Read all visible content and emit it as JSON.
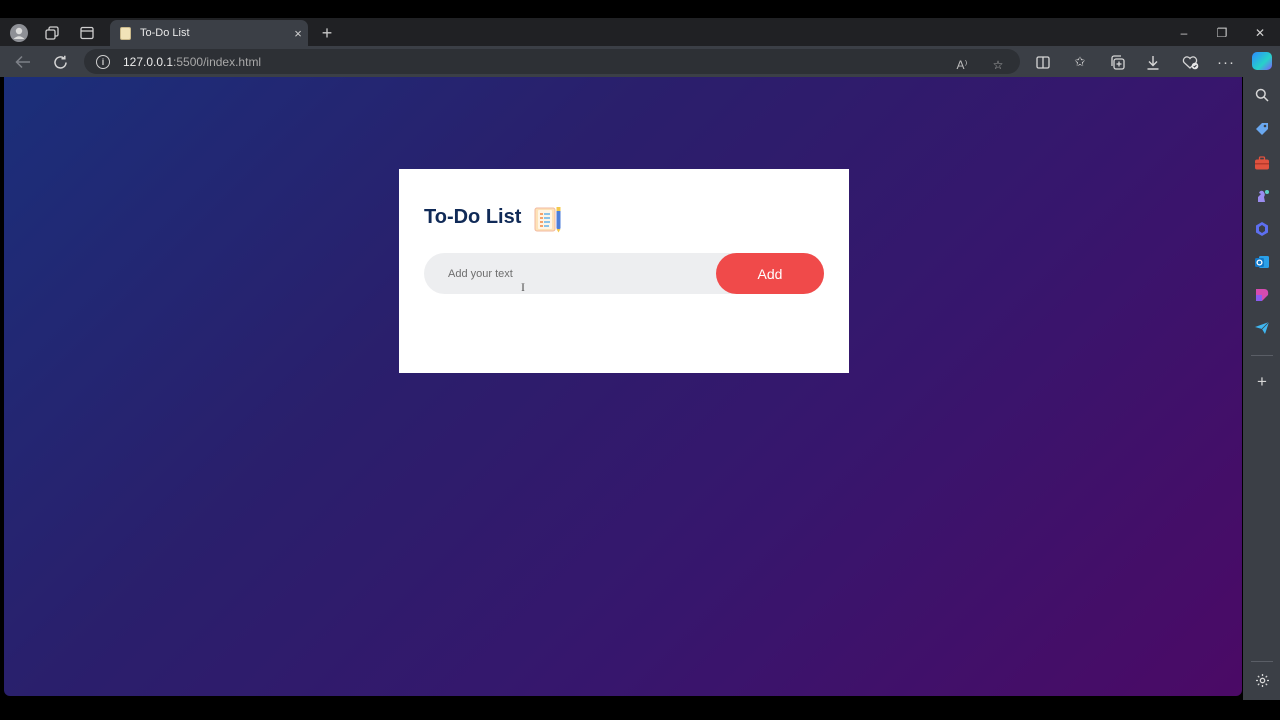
{
  "browser": {
    "tab": {
      "title": "To-Do List",
      "close_glyph": "×"
    },
    "new_tab_glyph": "+",
    "window_controls": {
      "minimize": "–",
      "restore": "❐",
      "close": "✕"
    },
    "address": {
      "host": "127.0.0.1",
      "rest": ":5500/index.html"
    },
    "read_aloud_label": "A⁾"
  },
  "app": {
    "title": "To-Do List",
    "input_placeholder": "Add your text",
    "add_button_label": "Add"
  },
  "colors": {
    "accent": "#f04a4a",
    "title": "#102a57",
    "gradient_start": "#1b2f7a",
    "gradient_end": "#4b0a66"
  }
}
